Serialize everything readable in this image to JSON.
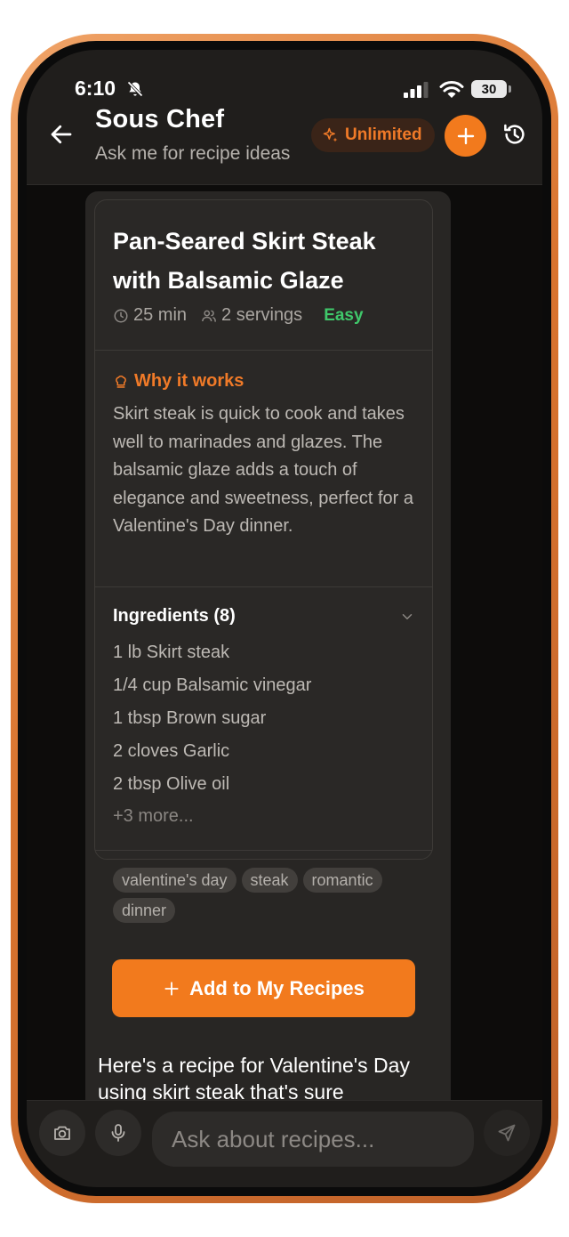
{
  "status_bar": {
    "time": "6:10",
    "battery": "30"
  },
  "header": {
    "title": "Sous Chef",
    "subtitle": "Ask me for recipe ideas",
    "badge_label": "Unlimited"
  },
  "recipe": {
    "title": "Pan-Seared Skirt Steak with Balsamic Glaze",
    "time": "25 min",
    "servings": "2 servings",
    "difficulty": "Easy",
    "why_label": "Why it works",
    "why_text": "Skirt steak is quick to cook and takes well to marinades and glazes. The balsamic glaze adds a touch of elegance and sweetness, perfect for a Valentine's Day dinner.",
    "ingredients_title": "Ingredients (8)",
    "ingredients": [
      "1 lb Skirt steak",
      "1/4 cup Balsamic vinegar",
      "1 tbsp Brown sugar",
      "2 cloves Garlic",
      "2 tbsp Olive oil"
    ],
    "more_label": "+3 more...",
    "tags": [
      "valentine's day",
      "steak",
      "romantic",
      "dinner"
    ],
    "add_button_label": "Add to My Recipes"
  },
  "message": {
    "text": "Here's a recipe for Valentine's Day using skirt steak that's sure"
  },
  "composer": {
    "placeholder": "Ask about recipes..."
  },
  "colors": {
    "accent": "#f27a1d",
    "difficulty_easy": "#3fc76a",
    "background": "#0d0c0b",
    "card": "#2a2826"
  },
  "icons": [
    "bell-slash-icon",
    "signal-icon",
    "wifi-icon",
    "back-arrow-icon",
    "sparkle-icon",
    "plus-icon",
    "history-icon",
    "clock-icon",
    "people-icon",
    "chef-hat-icon",
    "chevron-down-icon",
    "camera-icon",
    "microphone-icon",
    "send-icon"
  ]
}
